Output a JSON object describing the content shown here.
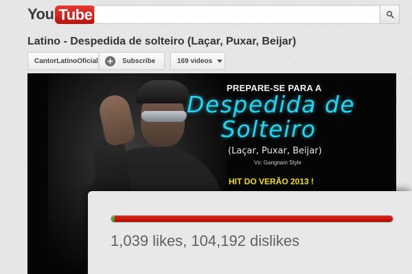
{
  "colors": {
    "brand_red": "#d12b24",
    "like_green": "#4aa81f",
    "dislike_red": "#c5150b",
    "promo_cyan": "#27d3ee",
    "promo_yellow": "#f5e000"
  },
  "header": {
    "logo_you": "You",
    "logo_tube": "Tube",
    "search_placeholder": "",
    "search_icon": "magnifier-icon"
  },
  "video": {
    "title": "Latino - Despedida de solteiro (Laçar, Puxar, Beijar)",
    "channel": "CantorLatinoOficial",
    "subscribe_label": "Subscribe",
    "videos_count_label": "169 videos",
    "thumbnail": {
      "line_top": "PREPARE-SE PARA A",
      "line_big_1": "Despedida de",
      "line_big_2": "Solteiro",
      "line_sub": "(Laçar, Puxar, Beijar)",
      "line_vs": "Vs: Gangnam Style",
      "line_hit": "HIT DO VERÃO 2013 !"
    }
  },
  "ratings": {
    "likes": 1039,
    "dislikes": 104192,
    "summary": "1,039 likes, 104,192 dislikes",
    "like_fraction": 0.0099
  }
}
